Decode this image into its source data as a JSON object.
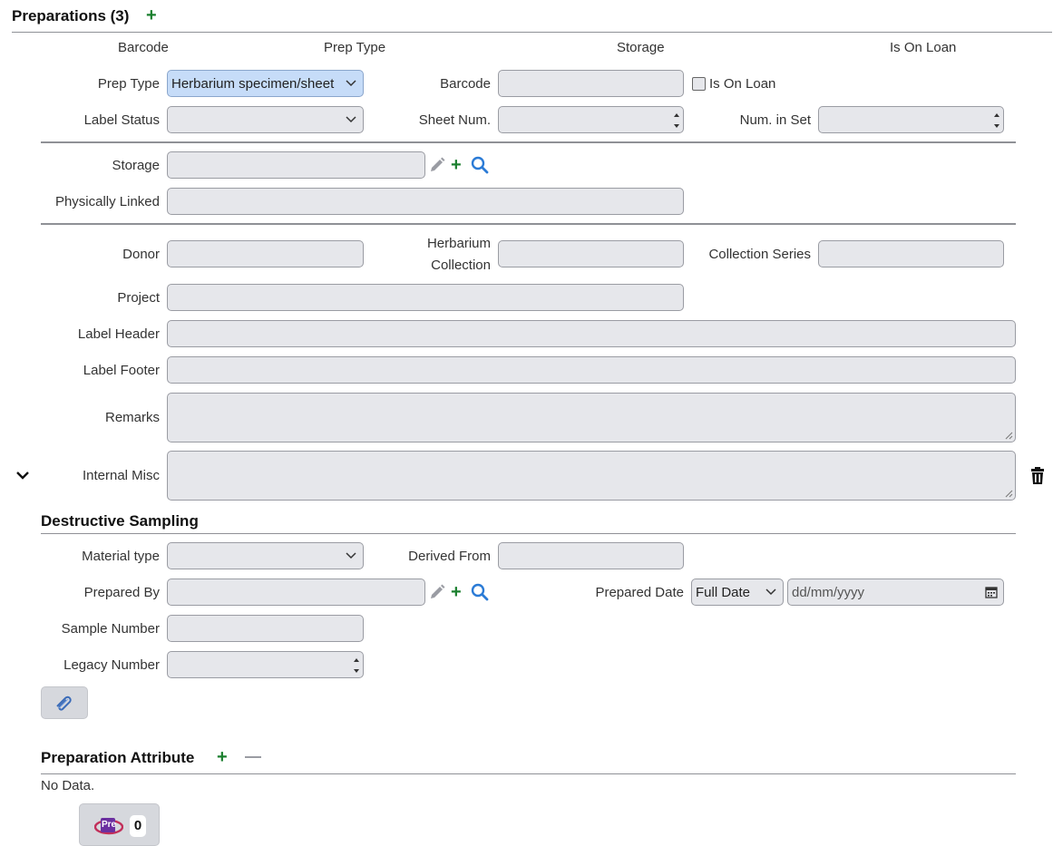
{
  "preparations": {
    "title": "Preparations (3)",
    "columns": [
      "Barcode",
      "Prep Type",
      "Storage",
      "Is On Loan"
    ]
  },
  "form": {
    "prep_type_label": "Prep Type",
    "prep_type_value": "Herbarium specimen/sheet",
    "barcode_label": "Barcode",
    "is_on_loan_label": "Is On Loan",
    "label_status_label": "Label Status",
    "sheet_num_label": "Sheet Num.",
    "num_in_set_label": "Num. in Set",
    "storage_label": "Storage",
    "physically_linked_label": "Physically Linked",
    "donor_label": "Donor",
    "herbarium_label_1": "Herbarium",
    "herbarium_label_2": "Collection",
    "collection_series_label": "Collection Series",
    "project_label": "Project",
    "label_header_label": "Label Header",
    "label_footer_label": "Label Footer",
    "remarks_label": "Remarks",
    "internal_misc_label": "Internal Misc"
  },
  "destructive": {
    "title": "Destructive Sampling",
    "material_type_label": "Material type",
    "derived_from_label": "Derived From",
    "prepared_by_label": "Prepared By",
    "prepared_date_label": "Prepared Date",
    "date_precision_value": "Full Date",
    "date_placeholder": "dd/mm/yyyy",
    "sample_number_label": "Sample Number",
    "legacy_number_label": "Legacy Number"
  },
  "attribute": {
    "title": "Preparation Attribute",
    "empty_text": "No Data.",
    "count": "0",
    "badge_text": "Pre"
  },
  "colors": {
    "add": "#1a7f2e",
    "search": "#2b7bd6",
    "field_bg": "#e6e7eb",
    "selected_bg": "#c6dcf8"
  }
}
